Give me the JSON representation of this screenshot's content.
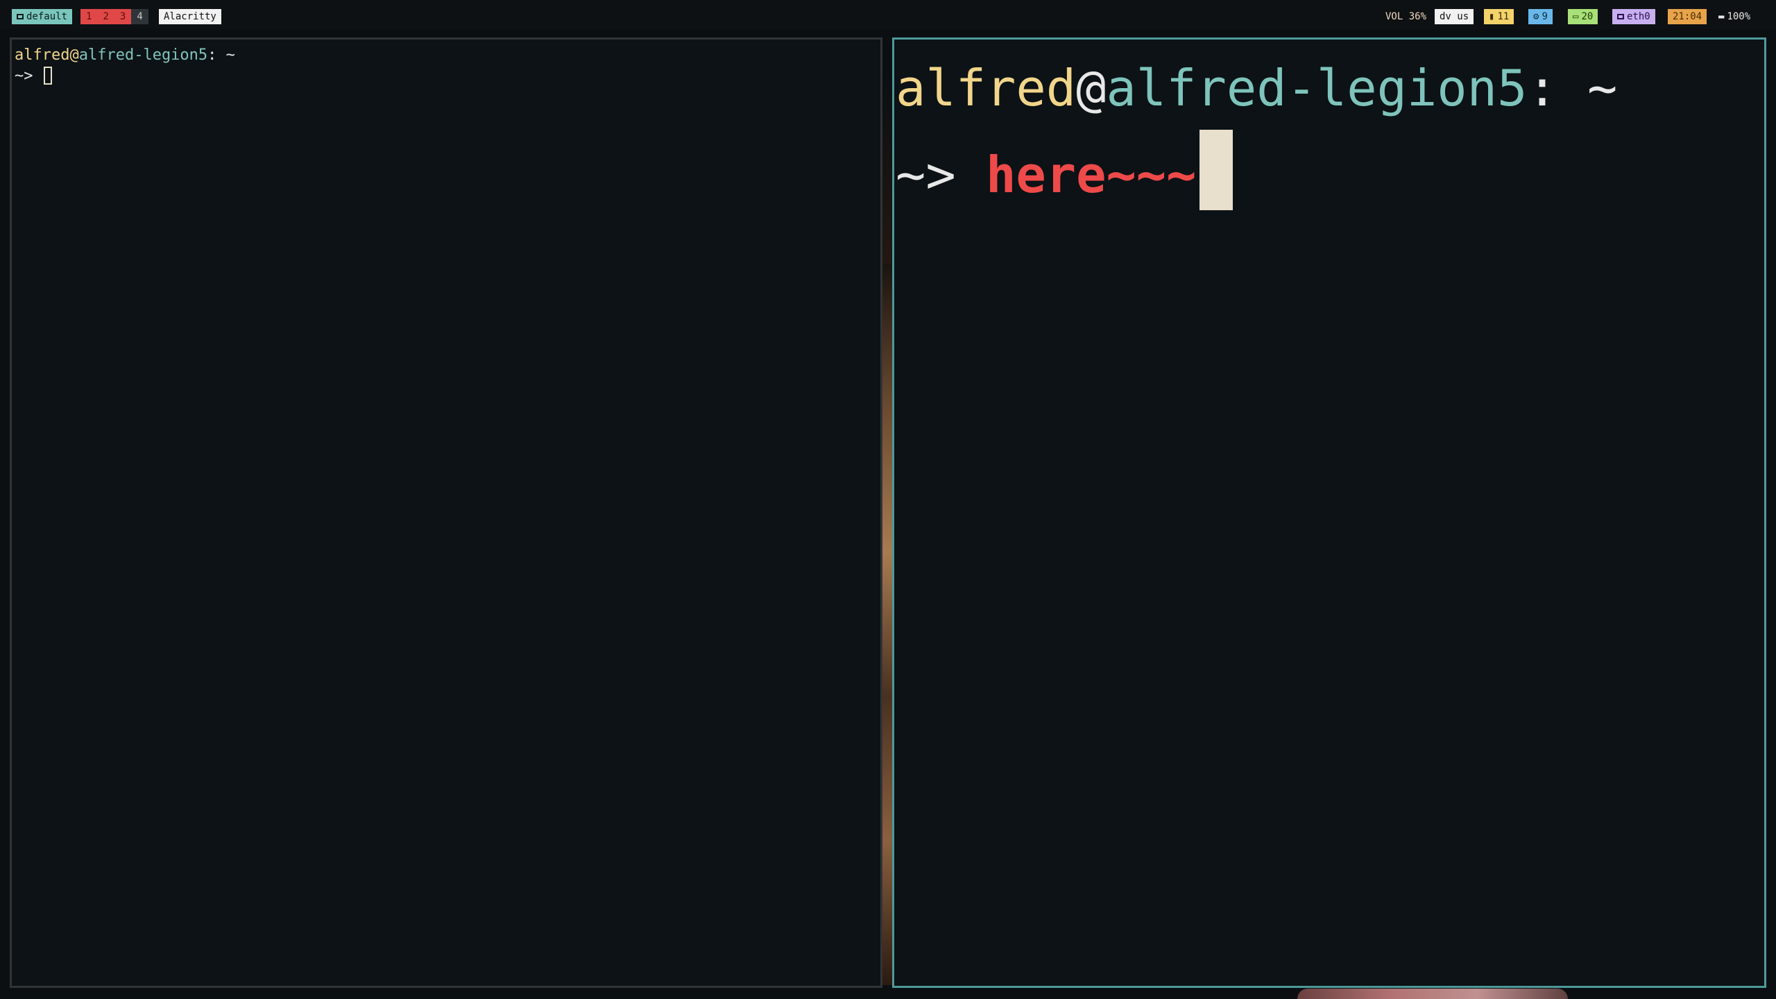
{
  "topbar": {
    "layout_label": "default",
    "workspaces": [
      {
        "label": "1",
        "active": true
      },
      {
        "label": "2",
        "active": true
      },
      {
        "label": "3",
        "active": true
      },
      {
        "label": "4",
        "active": false
      }
    ],
    "window_title": "Alacritty",
    "volume_label": "VOL",
    "volume_value": "36%",
    "keyboard_layout": "dv us",
    "cpu_value": "11",
    "temp_value": "9",
    "messages_value": "20",
    "network_label": "eth0",
    "clock": "21:04",
    "battery": "100%"
  },
  "terminal_left": {
    "user": "alfred",
    "at": "@",
    "host": "alfred-legion5",
    "path_sep": ": ~",
    "prompt": "~>",
    "input": ""
  },
  "terminal_right": {
    "user": "alfred",
    "at": "@",
    "host": "alfred-legion5",
    "path_sep": ": ~",
    "prompt": "~>",
    "input": "here~~~"
  },
  "colors": {
    "user": "#f1d58a",
    "host": "#7ec4bc",
    "input_red": "#ee4a4a",
    "focused_border": "#4d9a9a"
  }
}
